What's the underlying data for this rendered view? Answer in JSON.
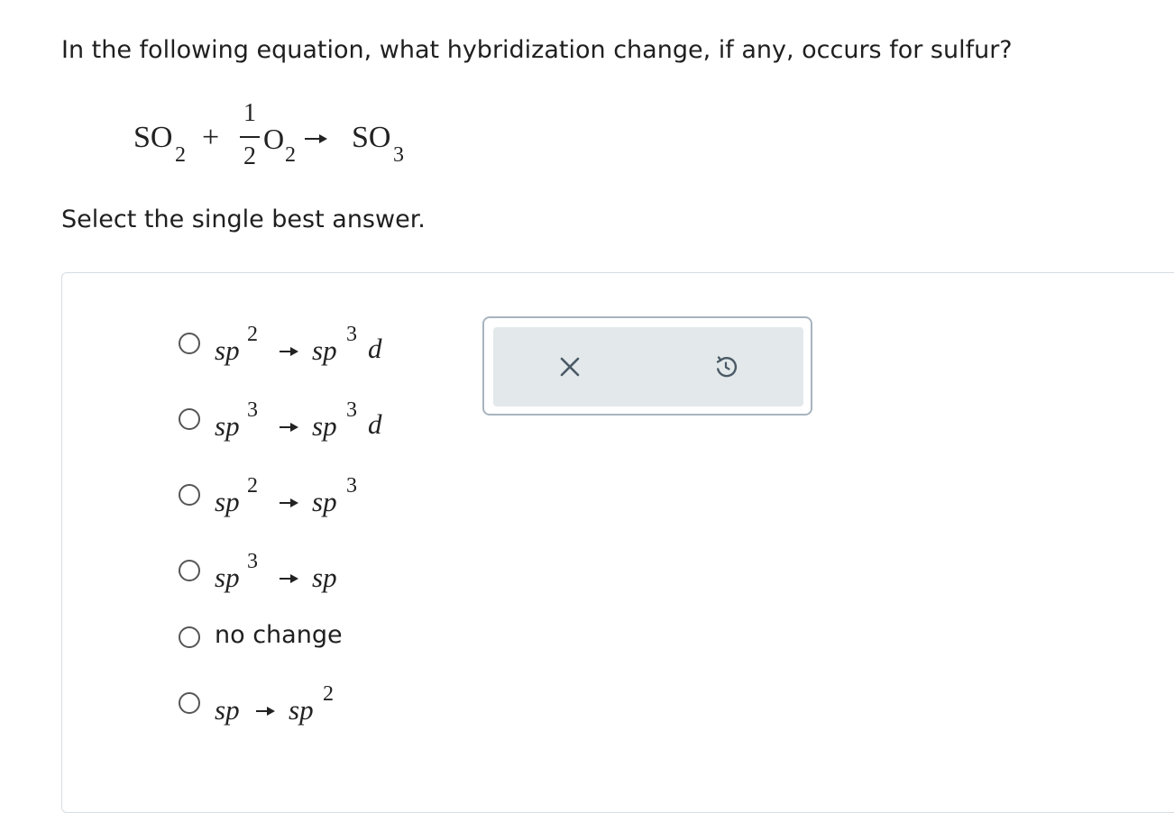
{
  "question": {
    "text": "In the following equation, what hybridization change, if any, occurs for sulfur?"
  },
  "equation": {
    "reactant1": "SO",
    "reactant1_sub": "2",
    "plus": "+",
    "frac_num": "1",
    "frac_den": "2",
    "reactant2": "O",
    "reactant2_sub": "2",
    "product": "SO",
    "product_sub": "3"
  },
  "instruction": "Select the single best answer.",
  "options": [
    {
      "from": "sp",
      "from_sup": "2",
      "to": "sp",
      "to_sup": "3",
      "to_suffix": "d"
    },
    {
      "from": "sp",
      "from_sup": "3",
      "to": "sp",
      "to_sup": "3",
      "to_suffix": "d"
    },
    {
      "from": "sp",
      "from_sup": "2",
      "to": "sp",
      "to_sup": "3",
      "to_suffix": ""
    },
    {
      "from": "sp",
      "from_sup": "3",
      "to": "sp",
      "to_sup": "",
      "to_suffix": ""
    },
    {
      "label": "no change"
    },
    {
      "from": "sp",
      "from_sup": "",
      "to": "sp",
      "to_sup": "2",
      "to_suffix": ""
    }
  ],
  "actions": {
    "clear_icon": "close-icon",
    "reset_icon": "undo-icon",
    "icon_color": "#4a5a66"
  }
}
